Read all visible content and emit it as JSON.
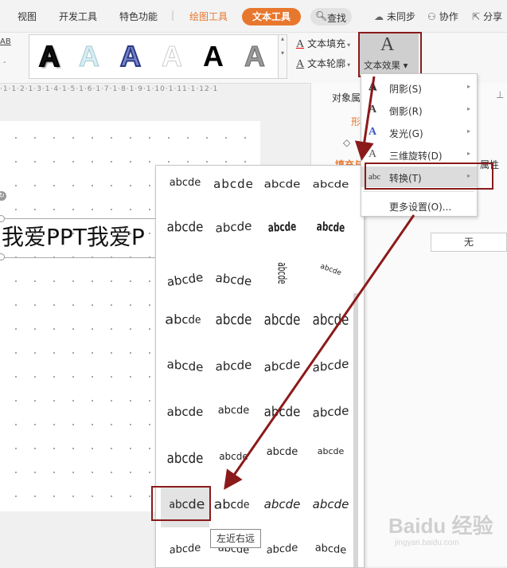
{
  "menubar": {
    "tabs": [
      "视图",
      "开发工具",
      "特色功能"
    ],
    "drawing_tools": "绘图工具",
    "text_tools": "文本工具",
    "search": "查找",
    "sync": "未同步",
    "collab": "协作",
    "share": "分享"
  },
  "ribbon": {
    "left_frag_top": "AB",
    "left_frag_mid": "-",
    "text_fill": "文本填充",
    "text_outline": "文本轮廓",
    "text_effect": "文本效果",
    "gallery_letter": "A"
  },
  "ruler": {
    "text": "·1·1·2·1·3·1·4·1·5·1·6·1·7·1·8·1·9·1·10·1·11·1·12·1"
  },
  "slide": {
    "text": "我爱PPT我爱P"
  },
  "panel": {
    "title": "对象属",
    "tab_shape": "形",
    "fill_frag": "填充与",
    "attr_frag": "属性",
    "none": "无"
  },
  "effect_menu": {
    "items": [
      {
        "label": "阴影(S)",
        "icon": "A"
      },
      {
        "label": "倒影(R)",
        "icon": "A"
      },
      {
        "label": "发光(G)",
        "icon": "A"
      },
      {
        "label": "三维旋转(D)",
        "icon": "A"
      },
      {
        "label": "转换(T)",
        "icon": "abc"
      }
    ],
    "more": "更多设置(O)..."
  },
  "transform_grid": {
    "rows": [
      [
        "abcde",
        "abcde",
        "abcde",
        "abcde"
      ],
      [
        "abcde",
        "abcde",
        "abcde",
        "abcde"
      ],
      [
        "abcde",
        "abcde",
        "abcde",
        "abcde"
      ],
      [
        "abcde",
        "abcde",
        "abcde",
        "abcde"
      ],
      [
        "abcde",
        "abcde",
        "abcde",
        "abcde"
      ],
      [
        "abcde",
        "abcde",
        "abcde",
        "abcde"
      ],
      [
        "abcde",
        "abcde",
        "abcde",
        "abcde"
      ],
      [
        "abcde",
        "abcde",
        "abcde",
        "abcde"
      ],
      [
        "abcde",
        "abcde",
        "abcde",
        "abcde"
      ]
    ],
    "tooltip": "左近右远"
  },
  "colors": {
    "accent": "#e8772e",
    "annotation": "#8b1a1a"
  },
  "watermark": {
    "main": "Baidu 经验",
    "sub": "jingyan.baidu.com"
  }
}
